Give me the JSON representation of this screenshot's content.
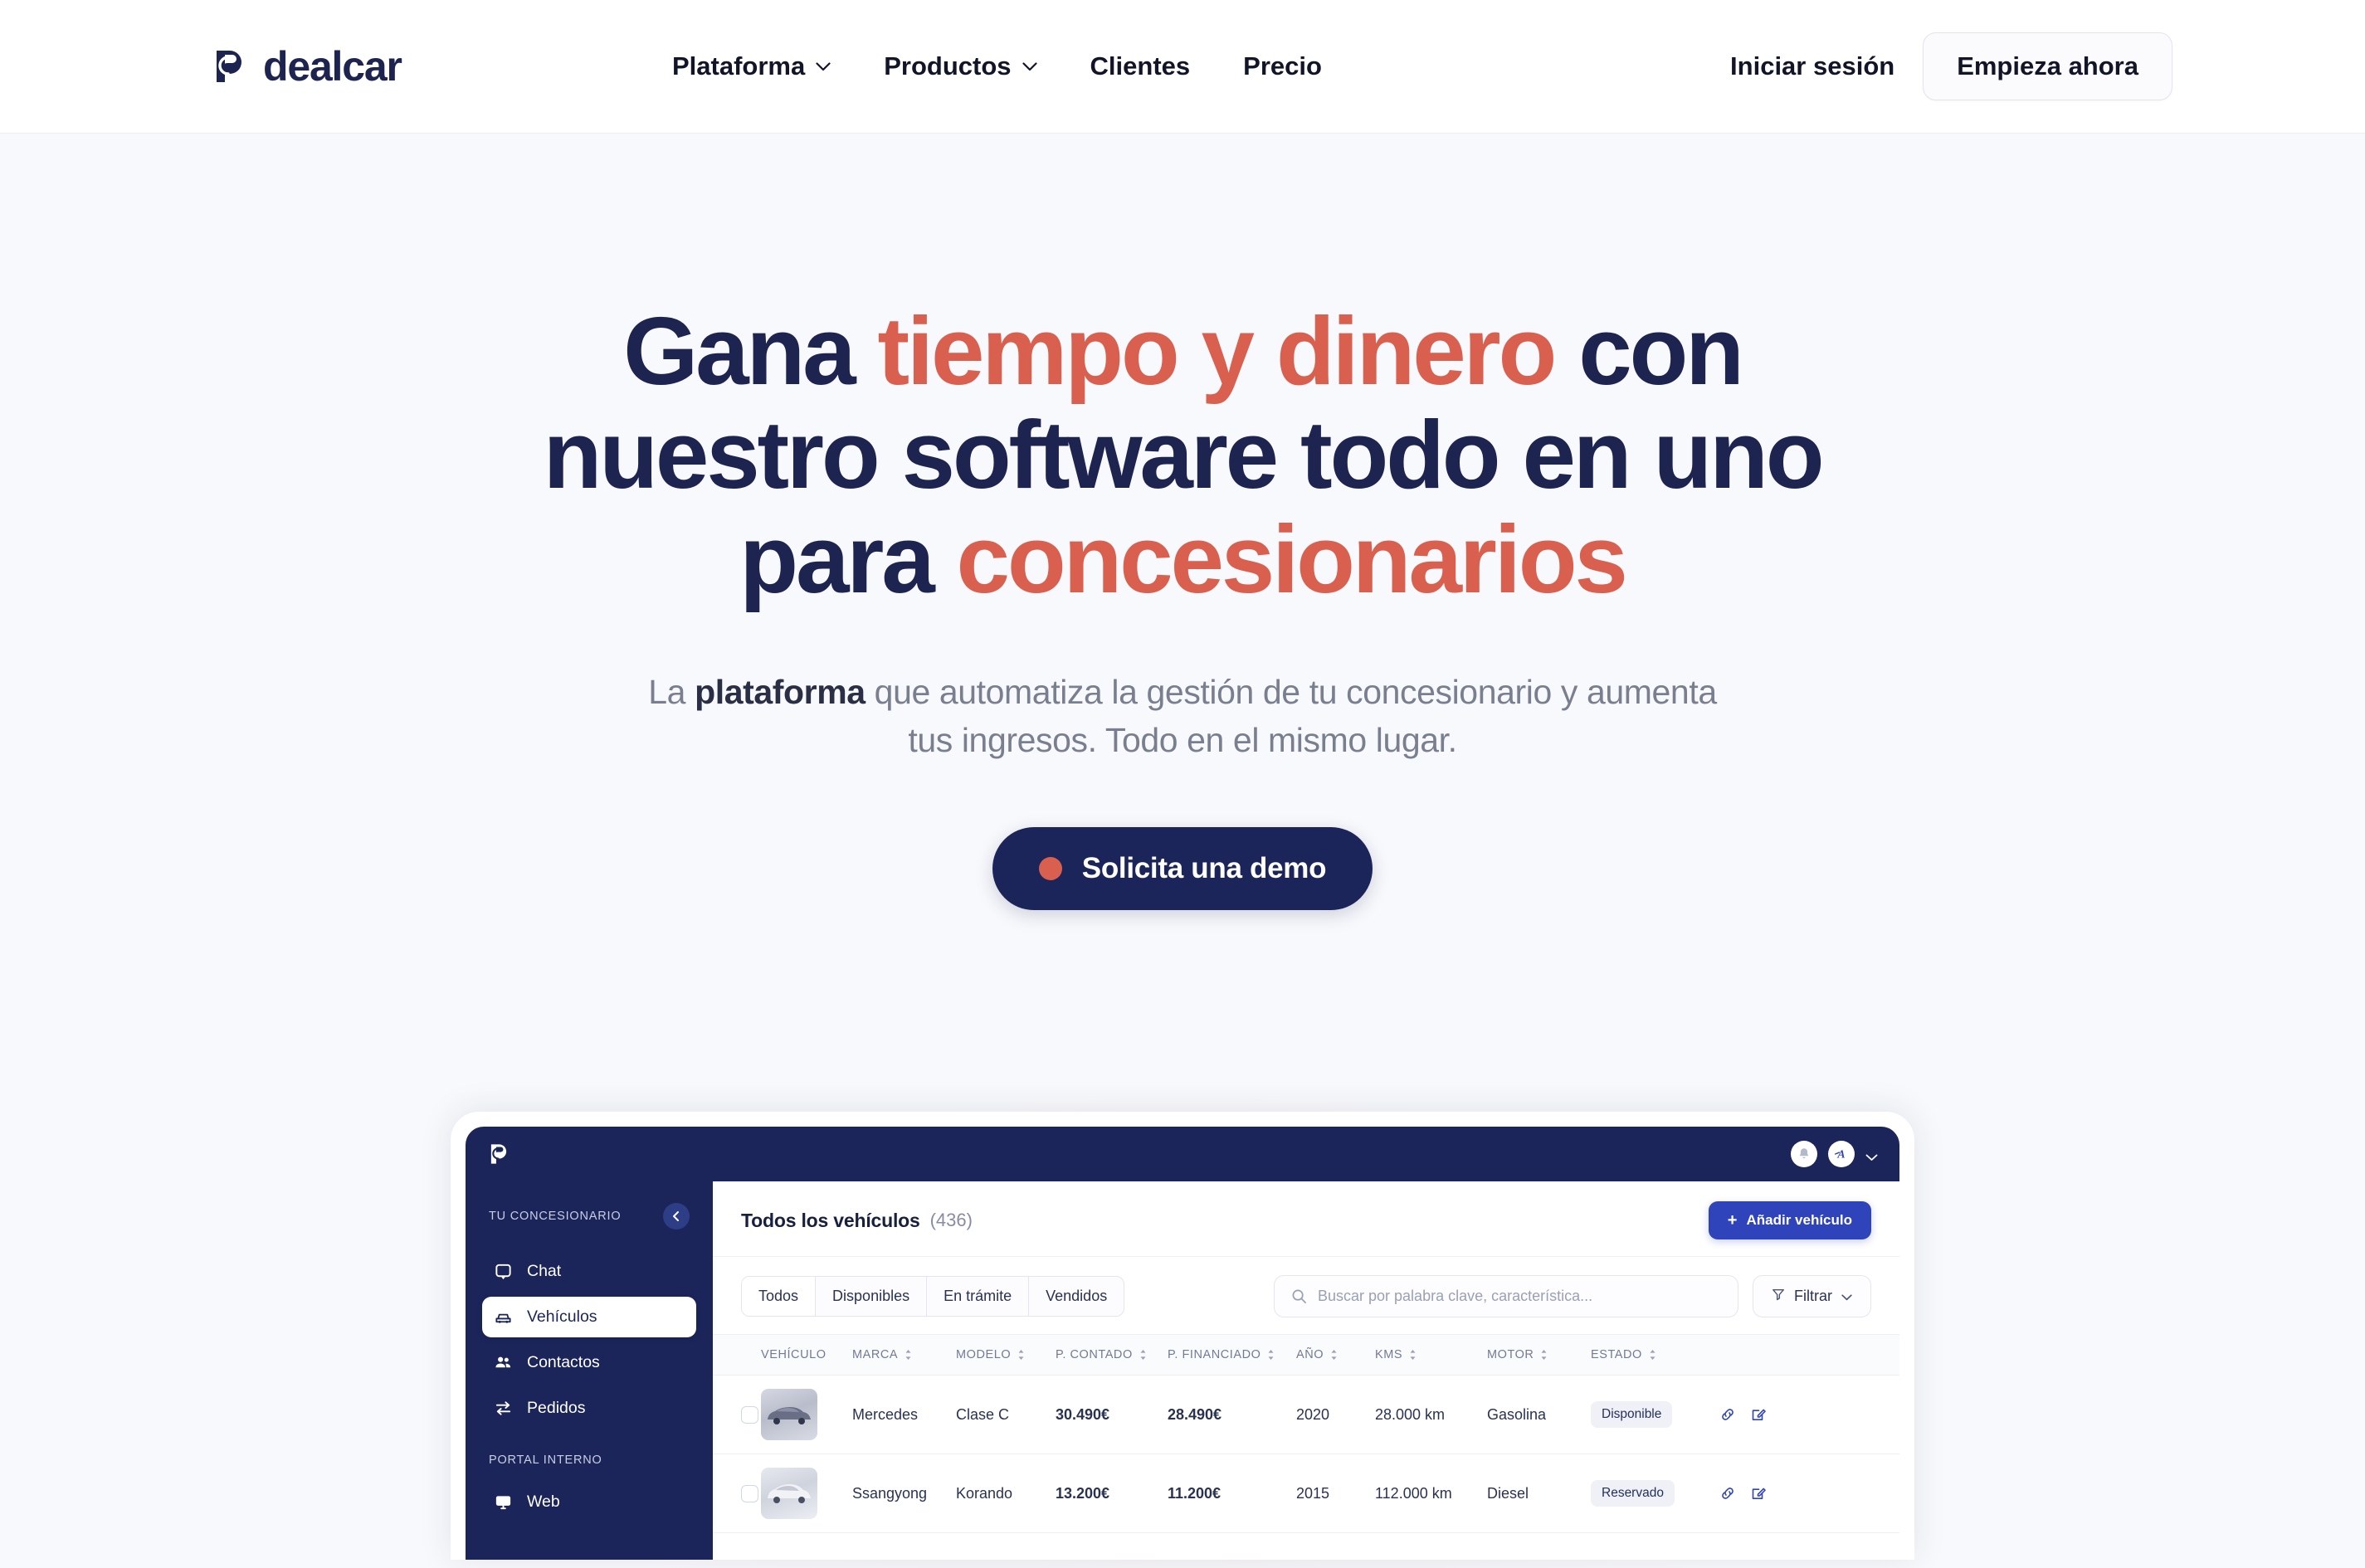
{
  "brand": {
    "name": "dealcar",
    "logo_icon": "dealcar-swirl-logo",
    "navy": "#1e2450",
    "coral": "#d9604f",
    "blue": "#2f43ba"
  },
  "header": {
    "nav": [
      {
        "label": "Plataforma",
        "has_dropdown": true,
        "icon": "chevron-down-icon"
      },
      {
        "label": "Productos",
        "has_dropdown": true,
        "icon": "chevron-down-icon"
      },
      {
        "label": "Clientes",
        "has_dropdown": false
      },
      {
        "label": "Precio",
        "has_dropdown": false
      }
    ],
    "login_label": "Iniciar sesión",
    "cta_label": "Empieza ahora"
  },
  "hero": {
    "heading": {
      "line1_a": "Gana ",
      "line1_hl": "tiempo y dinero",
      "line1_b": " con",
      "line2": "nuestro software todo en uno",
      "line3_a": "para ",
      "line3_hl": "concesionarios"
    },
    "subtitle_a": "La ",
    "subtitle_bold": "plataforma",
    "subtitle_b": " que automatiza la gestión de tu concesionario y aumenta tus ingresos. Todo en el mismo lugar.",
    "cta_label": "Solicita una demo",
    "cta_dot_color": "#d9604f"
  },
  "app": {
    "topbar": {
      "logo_icon": "dealcar-swirl-logo",
      "bell_icon": "notification-bell-icon",
      "avatar_label": "A",
      "avatar_chevron_icon": "chevron-down-icon"
    },
    "sidebar": {
      "section_1_label": "TU CONCESIONARIO",
      "collapse_icon": "chevron-left-icon",
      "items_1": [
        {
          "label": "Chat",
          "icon": "chat-icon",
          "active": false
        },
        {
          "label": "Vehículos",
          "icon": "car-icon",
          "active": true
        },
        {
          "label": "Contactos",
          "icon": "users-icon",
          "active": false
        },
        {
          "label": "Pedidos",
          "icon": "transfer-arrows-icon",
          "active": false
        }
      ],
      "section_2_label": "PORTAL INTERNO",
      "items_2": [
        {
          "label": "Web",
          "icon": "monitor-icon",
          "active": false
        }
      ]
    },
    "main": {
      "title": "Todos los vehículos",
      "count": "(436)",
      "add_button_label": "Añadir vehículo",
      "add_button_icon": "plus-icon",
      "tabs": [
        {
          "label": "Todos",
          "active": true
        },
        {
          "label": "Disponibles",
          "active": false
        },
        {
          "label": "En trámite",
          "active": false
        },
        {
          "label": "Vendidos",
          "active": false
        }
      ],
      "search_placeholder": "Buscar por palabra clave, característica...",
      "search_icon": "search-icon",
      "filter_label": "Filtrar",
      "filter_icon": "funnel-icon",
      "filter_chevron_icon": "chevron-down-icon",
      "table": {
        "columns": [
          {
            "label": "VEHÍCULO",
            "sortable": false
          },
          {
            "label": "MARCA",
            "sortable": true
          },
          {
            "label": "MODELO",
            "sortable": true
          },
          {
            "label": "P. CONTADO",
            "sortable": true
          },
          {
            "label": "P. FINANCIADO",
            "sortable": true
          },
          {
            "label": "AÑO",
            "sortable": true
          },
          {
            "label": "KMS",
            "sortable": true
          },
          {
            "label": "MOTOR",
            "sortable": true
          },
          {
            "label": "ESTADO",
            "sortable": true
          }
        ],
        "rows": [
          {
            "thumb": "dark-sedan-photo",
            "marca": "Mercedes",
            "modelo": "Clase C",
            "p_contado": "30.490€",
            "p_financiado": "28.490€",
            "anio": "2020",
            "kms": "28.000 km",
            "motor": "Gasolina",
            "estado": "Disponible",
            "actions": [
              "link-icon",
              "edit-icon"
            ]
          },
          {
            "thumb": "white-suv-photo",
            "marca": "Ssangyong",
            "modelo": "Korando",
            "p_contado": "13.200€",
            "p_financiado": "11.200€",
            "anio": "2015",
            "kms": "112.000 km",
            "motor": "Diesel",
            "estado": "Reservado",
            "actions": [
              "link-icon",
              "edit-icon"
            ]
          }
        ]
      }
    }
  }
}
